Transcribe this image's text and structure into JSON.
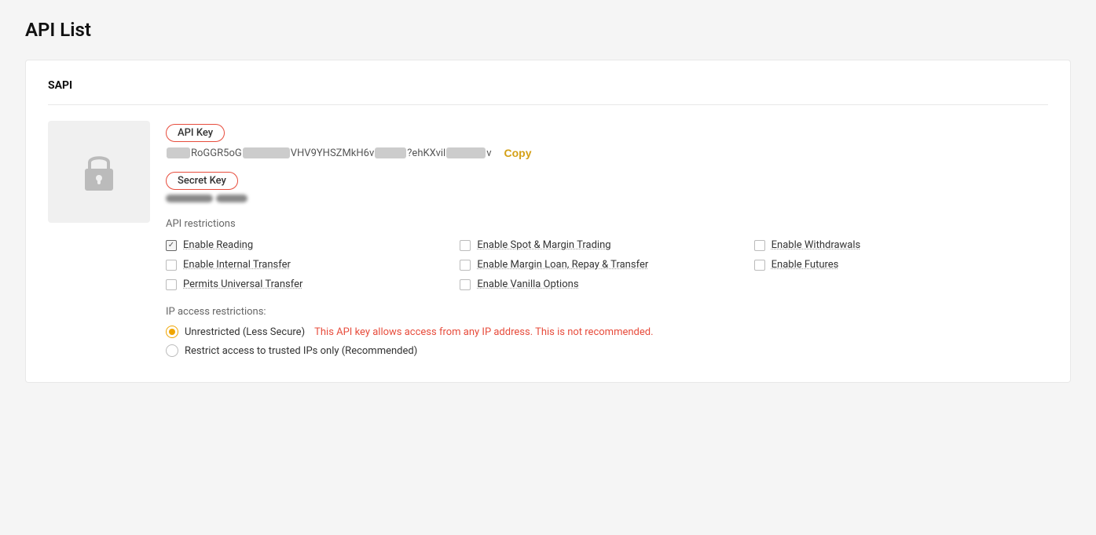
{
  "page": {
    "title": "API List"
  },
  "section": {
    "label": "SAPI"
  },
  "api_key": {
    "label": "API Key",
    "value_prefix": "",
    "value_visible": "RoGGR5oG",
    "value_middle": "VHV9YHSZMkH6v",
    "value_end": "?ehKXvil",
    "value_suffix": "v",
    "copy_label": "Copy"
  },
  "secret_key": {
    "label": "Secret Key"
  },
  "restrictions": {
    "title": "API restrictions",
    "items": [
      {
        "id": "enable-reading",
        "label": "Enable Reading",
        "checked": true,
        "col": 1
      },
      {
        "id": "enable-spot",
        "label": "Enable Spot & Margin Trading",
        "checked": false,
        "col": 2
      },
      {
        "id": "enable-withdrawals",
        "label": "Enable Withdrawals",
        "checked": false,
        "col": 3
      },
      {
        "id": "enable-internal-transfer",
        "label": "Enable Internal Transfer",
        "checked": false,
        "col": 1
      },
      {
        "id": "enable-margin-loan",
        "label": "Enable Margin Loan, Repay & Transfer",
        "checked": false,
        "col": 2
      },
      {
        "id": "enable-futures",
        "label": "Enable Futures",
        "checked": false,
        "col": 3
      },
      {
        "id": "permits-universal-transfer",
        "label": "Permits Universal Transfer",
        "checked": false,
        "col": 1
      },
      {
        "id": "enable-vanilla-options",
        "label": "Enable Vanilla Options",
        "checked": false,
        "col": 2
      }
    ]
  },
  "ip_restrictions": {
    "title": "IP access restrictions:",
    "options": [
      {
        "id": "unrestricted",
        "label": "Unrestricted (Less Secure)",
        "warning": "This API key allows access from any IP address. This is not recommended.",
        "selected": true
      },
      {
        "id": "trusted",
        "label": "Restrict access to trusted IPs only (Recommended)",
        "warning": "",
        "selected": false
      }
    ]
  }
}
